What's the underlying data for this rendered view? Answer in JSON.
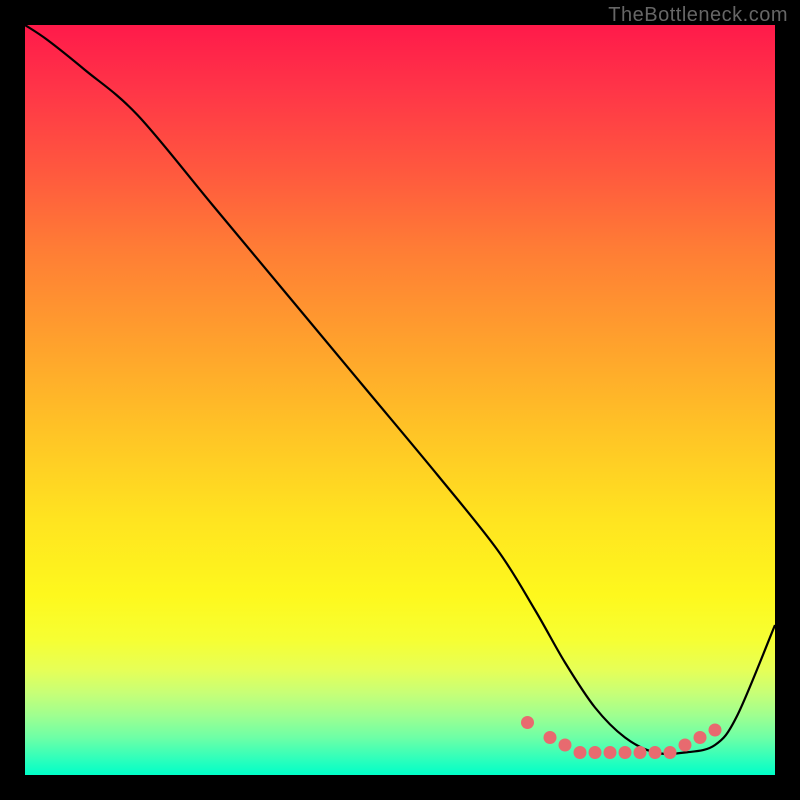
{
  "watermark": "TheBottleneck.com",
  "colors": {
    "frame_bg": "#000000",
    "curve": "#000000",
    "dot": "#e86a6f",
    "gradient_top": "#ff1a4a",
    "gradient_bottom": "#00ffc8"
  },
  "chart_data": {
    "type": "line",
    "title": "",
    "xlabel": "",
    "ylabel": "",
    "xlim": [
      0,
      100
    ],
    "ylim": [
      0,
      100
    ],
    "grid": false,
    "legend": false,
    "series": [
      {
        "name": "bottleneck-curve",
        "x": [
          0,
          3,
          8,
          15,
          25,
          35,
          45,
          55,
          63,
          68,
          72,
          76,
          80,
          84,
          88,
          92,
          95,
          100
        ],
        "y": [
          100,
          98,
          94,
          88,
          76,
          64,
          52,
          40,
          30,
          22,
          15,
          9,
          5,
          3,
          3,
          4,
          8,
          20
        ]
      }
    ],
    "highlight_points": {
      "name": "optimal-range-dots",
      "x": [
        67,
        70,
        72,
        74,
        76,
        78,
        80,
        82,
        84,
        86,
        88,
        90,
        92
      ],
      "y": [
        7,
        5,
        4,
        3,
        3,
        3,
        3,
        3,
        3,
        3,
        4,
        5,
        6
      ]
    }
  }
}
